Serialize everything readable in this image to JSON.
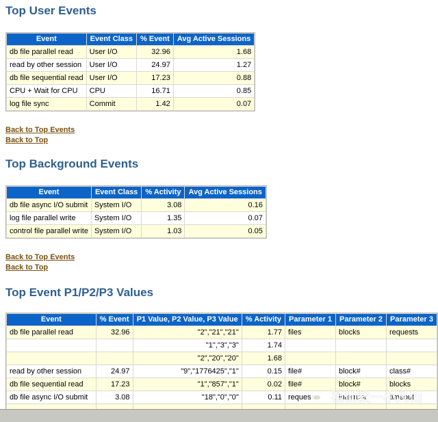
{
  "sections": {
    "top_user_events": {
      "title": "Top User Events",
      "columns": [
        "Event",
        "Event Class",
        "% Event",
        "Avg Active Sessions"
      ],
      "rows": [
        [
          "db file parallel read",
          "User I/O",
          "32.96",
          "1.68"
        ],
        [
          "read by other session",
          "User I/O",
          "24.97",
          "1.27"
        ],
        [
          "db file sequential read",
          "User I/O",
          "17.23",
          "0.88"
        ],
        [
          "CPU + Wait for CPU",
          "CPU",
          "16.71",
          "0.85"
        ],
        [
          "log file sync",
          "Commit",
          "1.42",
          "0.07"
        ]
      ]
    },
    "top_background_events": {
      "title": "Top Background Events",
      "columns": [
        "Event",
        "Event Class",
        "% Activity",
        "Avg Active Sessions"
      ],
      "rows": [
        [
          "db file async I/O submit",
          "System I/O",
          "3.08",
          "0.16"
        ],
        [
          "log file parallel write",
          "System I/O",
          "1.35",
          "0.07"
        ],
        [
          "control file parallel write",
          "System I/O",
          "1.03",
          "0.05"
        ]
      ]
    },
    "top_event_p1p2p3": {
      "title": "Top Event P1/P2/P3 Values",
      "columns": [
        "Event",
        "% Event",
        "P1 Value, P2 Value, P3 Value",
        "% Activity",
        "Parameter 1",
        "Parameter 2",
        "Parameter 3"
      ],
      "rows": [
        [
          "db file parallel read",
          "32.96",
          "\"2\",\"21\",\"21\"",
          "1.77",
          "files",
          "blocks",
          "requests"
        ],
        [
          "",
          "",
          "\"1\",\"3\",\"3\"",
          "1.74",
          "",
          "",
          ""
        ],
        [
          "",
          "",
          "\"2\",\"20\",\"20\"",
          "1.68",
          "",
          "",
          ""
        ],
        [
          "read by other session",
          "24.97",
          "\"9\",\"1776425\",\"1\"",
          "0.15",
          "file#",
          "block#",
          "class#"
        ],
        [
          "db file sequential read",
          "17.23",
          "\"1\",\"857\",\"1\"",
          "0.02",
          "file#",
          "block#",
          "blocks"
        ],
        [
          "db file async I/O submit",
          "3.08",
          "\"18\",\"0\",\"0\"",
          "0.11",
          "requests",
          "interrupt",
          "timeout"
        ],
        [
          "",
          "",
          "",
          "",
          "",
          "",
          ""
        ]
      ]
    }
  },
  "links": {
    "group1": [
      {
        "label": "Back to Top Events"
      },
      {
        "label": "Back to Top"
      }
    ],
    "group2": [
      {
        "label": "Back to Top Events"
      },
      {
        "label": "Back to Top"
      }
    ]
  },
  "watermark": {
    "text": "祖仙教一小凡仙",
    "logo_icon": "wechat-avatar-icon"
  },
  "theme": {
    "header_bg": "#0d64c8",
    "header_fg": "#ffffff",
    "row_alt_bg": "#ffffdd",
    "row_bg": "#ffffff",
    "title_color": "#2e5f8f",
    "link_color": "#7a5110",
    "page_bg": "#ffffff",
    "gutter_bg": "#c8c8c2"
  }
}
